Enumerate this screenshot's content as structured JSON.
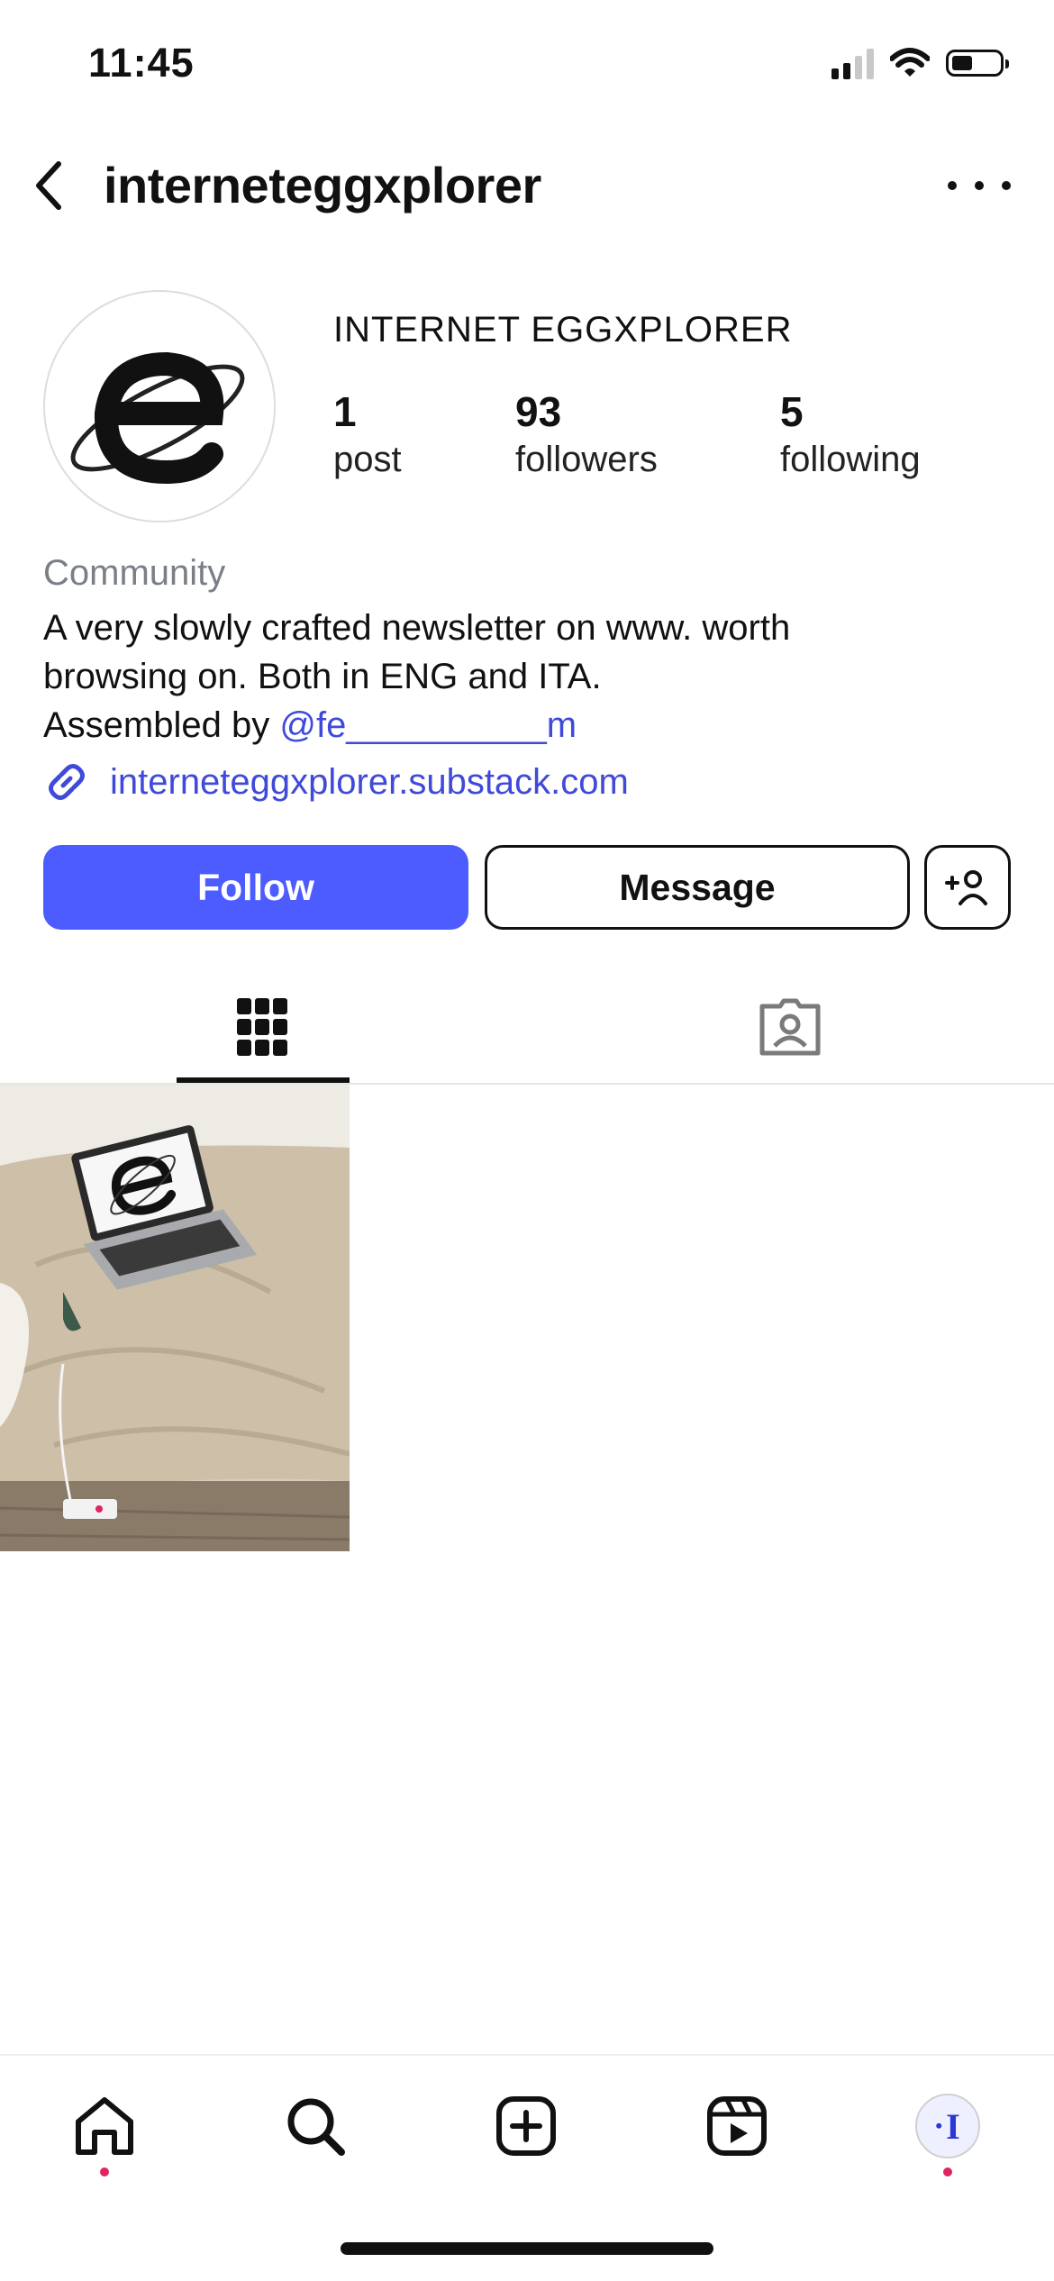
{
  "status_bar": {
    "time": "11:45"
  },
  "header": {
    "username": "interneteggxplorer"
  },
  "profile": {
    "display_name": "INTERNET EGGXPLORER",
    "stats": [
      {
        "count": "1",
        "label": "post"
      },
      {
        "count": "93",
        "label": "followers"
      },
      {
        "count": "5",
        "label": "following"
      }
    ],
    "category": "Community",
    "bio_line1": "A very slowly crafted newsletter on www. worth",
    "bio_line2": "browsing on. Both in ENG and ITA.",
    "bio_line3_prefix": "Assembled by ",
    "bio_mention": "@fe__________m",
    "link": "interneteggxplorer.substack.com"
  },
  "actions": {
    "follow_label": "Follow",
    "message_label": "Message"
  },
  "tabs": [
    {
      "name": "grid",
      "icon": "grid-icon",
      "active": true
    },
    {
      "name": "tagged",
      "icon": "tagged-person-icon",
      "active": false
    }
  ],
  "posts": [
    {
      "description": "laptop on bed showing e logo"
    }
  ],
  "bottom_nav": [
    "home-icon",
    "search-icon",
    "create-icon",
    "reels-icon",
    "profile-avatar"
  ],
  "colors": {
    "accent": "#4d5cff",
    "link": "#3f4ad9",
    "notification_dot": "#e0245e"
  }
}
